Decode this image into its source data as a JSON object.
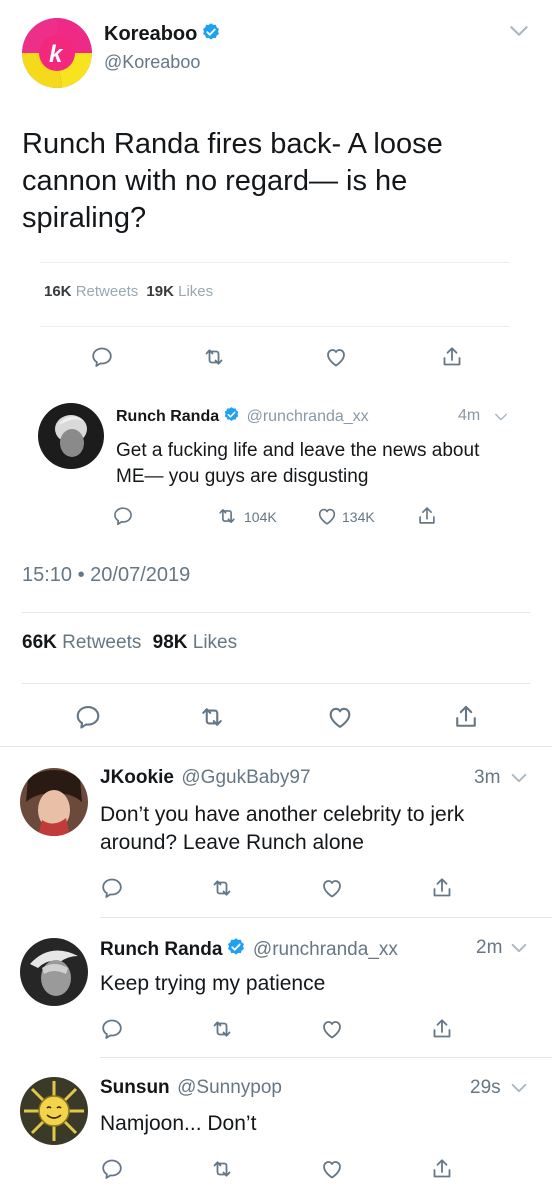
{
  "main_tweet": {
    "display_name": "Koreaboo",
    "handle": "@Koreaboo",
    "text": "Runch Randa fires back- A loose cannon with no regard— is he spiraling?",
    "quoted_screenshot": {
      "retweets_count": "16K",
      "retweets_label": "Retweets",
      "likes_count": "19K",
      "likes_label": "Likes",
      "inner_tweet": {
        "display_name": "Runch Randa",
        "handle": "@runchranda_xx",
        "time": "4m",
        "text": "Get a fucking life and leave the news about ME— you guys are disgusting",
        "retweets": "104K",
        "likes": "134K"
      }
    },
    "timestamp": "15:10 • 20/07/2019",
    "retweets_count": "66K",
    "retweets_label": "Retweets",
    "likes_count": "98K",
    "likes_label": "Likes"
  },
  "replies": [
    {
      "display_name": "JKookie",
      "handle": "@GgukBaby97",
      "time": "3m",
      "text": "Don’t you have another celebrity to jerk around? Leave Runch alone"
    },
    {
      "display_name": "Runch Randa",
      "handle": "@runchranda_xx",
      "time": "2m",
      "text": "Keep trying my patience"
    },
    {
      "display_name": "Sunsun",
      "handle": "@Sunnypop",
      "time": "29s",
      "text": "Namjoon... Don’t"
    }
  ],
  "colors": {
    "text": "#14171a",
    "secondary": "#657786",
    "divider": "#e1e8ed",
    "verified": "#1da1f2"
  },
  "icons": [
    "reply-icon",
    "retweet-icon",
    "like-icon",
    "share-icon",
    "chevron-down-icon",
    "verified-badge-icon"
  ]
}
